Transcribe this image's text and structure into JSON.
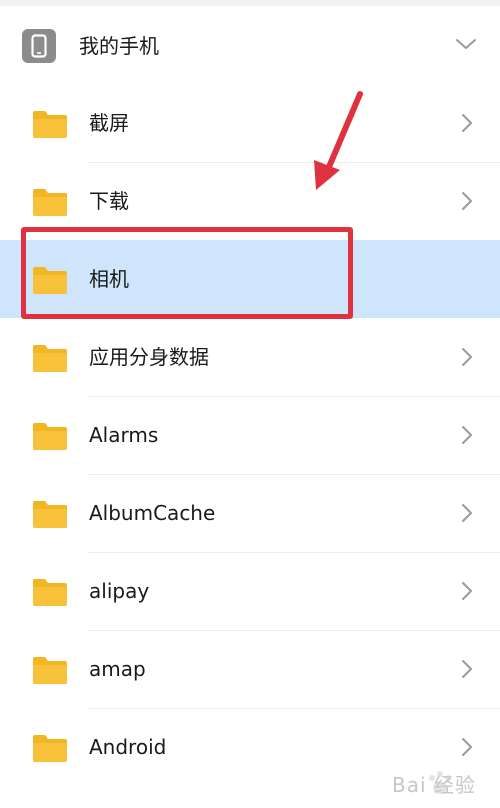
{
  "storage": {
    "title": "我的手机",
    "icon": "phone-icon",
    "expanded": true
  },
  "folders": [
    {
      "label": "截屏",
      "icon": "folder-icon",
      "selected": false
    },
    {
      "label": "下载",
      "icon": "folder-icon",
      "selected": false
    },
    {
      "label": "相机",
      "icon": "folder-icon",
      "selected": true
    },
    {
      "label": "应用分身数据",
      "icon": "folder-icon",
      "selected": false
    },
    {
      "label": "Alarms",
      "icon": "folder-icon",
      "selected": false
    },
    {
      "label": "AlbumCache",
      "icon": "folder-icon",
      "selected": false
    },
    {
      "label": "alipay",
      "icon": "folder-icon",
      "selected": false
    },
    {
      "label": "amap",
      "icon": "folder-icon",
      "selected": false
    },
    {
      "label": "Android",
      "icon": "folder-icon",
      "selected": false
    }
  ],
  "annotation": {
    "highlight_color": "#e0323e",
    "arrow_color": "#e0323e"
  },
  "colors": {
    "selected_row": "#cfe5fb",
    "folder": "#f7c23a",
    "folder_tab": "#f3b623"
  },
  "watermark": {
    "text": "Bai 经验"
  }
}
